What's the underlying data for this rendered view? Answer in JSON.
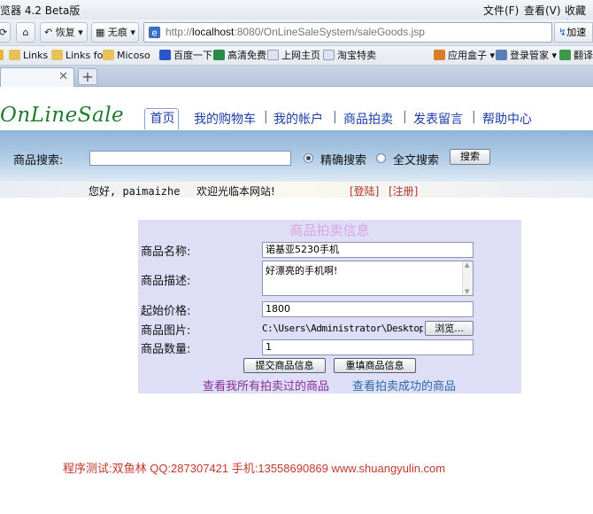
{
  "browser": {
    "window_title": "览器 4.2 Beta版",
    "menus": [
      "文件(F)",
      "查看(V)",
      "收藏(F"
    ],
    "nav": {
      "restore_label": "恢复",
      "noreferer_label": "无痕",
      "url_prefix": "http://",
      "url_host": "localhost",
      "url_rest": ":8080/OnLineSaleSystem/saleGoods.jsp",
      "go_label": "加速"
    },
    "favorites": [
      "Links",
      "Links fo",
      "Micoso",
      "百度一下",
      "高清免费",
      "上网主页",
      "淘宝特卖",
      "应用盒子",
      "登录管家",
      "翻译"
    ]
  },
  "site": {
    "logo": "OnLineSale",
    "nav_items": [
      "首页",
      "我的购物车",
      "我的帐户",
      "商品拍卖",
      "发表留言",
      "帮助中心"
    ],
    "search": {
      "label": "商品搜索:",
      "exact_label": "精确搜索",
      "fulltext_label": "全文搜索",
      "button_label": "搜索",
      "selected": "精确搜索"
    },
    "welcome": {
      "greeting": "您好, paimaizhe",
      "message": "欢迎光临本网站!",
      "login_link": "[登陆]",
      "register_link": "[注册]"
    }
  },
  "form": {
    "title": "商品拍卖信息",
    "name_label": "商品名称:",
    "name_value": "诺基亚5230手机",
    "desc_label": "商品描述:",
    "desc_value": "好漂亮的手机啊!",
    "price_label": "起始价格:",
    "price_value": "1800",
    "image_label": "商品图片:",
    "image_value": "C:\\Users\\Administrator\\Desktop\\",
    "browse_label": "浏览...",
    "qty_label": "商品数量:",
    "qty_value": "1",
    "submit_label": "提交商品信息",
    "reset_label": "重填商品信息",
    "link_all_auctions": "查看我所有拍卖过的商品",
    "link_success_auctions": "查看拍卖成功的商品"
  },
  "footer": {
    "text": "程序测试:双鱼林 QQ:287307421 手机:13558690869 www.shuangyulin.com"
  },
  "colors": {
    "link_blue": "#1d3da8",
    "link_purple": "#8a2c9a",
    "link_teal": "#2a6aa8",
    "footer_red": "#c0392b",
    "panel_bg": "#dedff7"
  }
}
